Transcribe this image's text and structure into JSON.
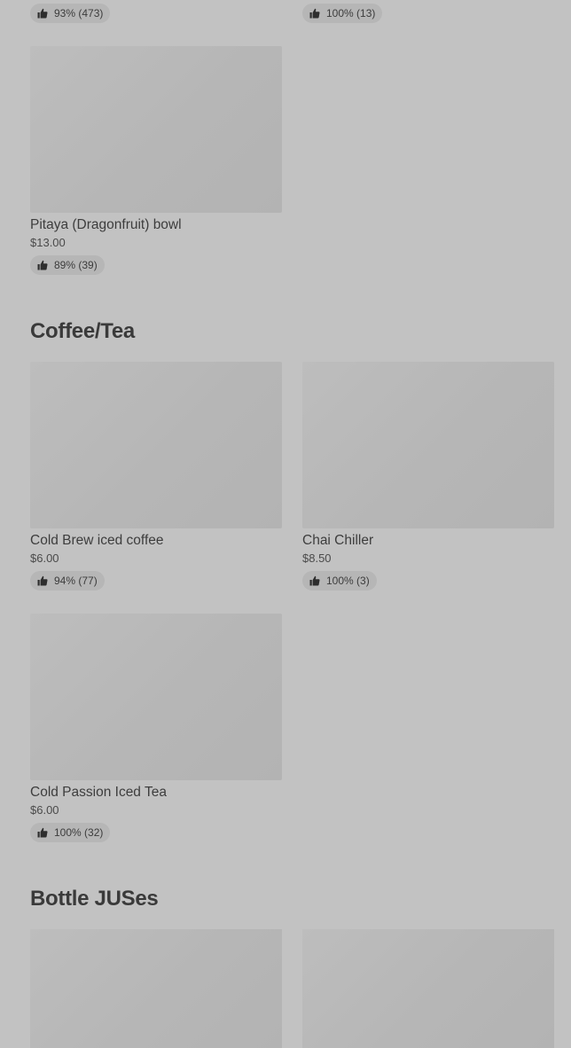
{
  "top_partial": {
    "left_rating": "93% (473)",
    "right_rating": "100% (13)"
  },
  "pitaya": {
    "name": "Pitaya (Dragonfruit) bowl",
    "price": "$13.00",
    "rating": "89% (39)"
  },
  "sections": {
    "coffee_tea": {
      "title": "Coffee/Tea",
      "items": [
        {
          "name": "Cold Brew iced coffee",
          "price": "$6.00",
          "rating": "94% (77)"
        },
        {
          "name": "Chai Chiller",
          "price": "$8.50",
          "rating": "100% (3)"
        },
        {
          "name": "Cold Passion Iced Tea",
          "price": "$6.00",
          "rating": "100% (32)"
        }
      ]
    },
    "bottle_juses": {
      "title": "Bottle JUSes"
    }
  },
  "icons": {
    "rating": "thumbs-up-icon"
  },
  "colors": {
    "background": "#c2c2c2",
    "image_placeholder": "#b8b8b8",
    "pill": "#b6b6b6",
    "text": "#3c3c3c"
  }
}
